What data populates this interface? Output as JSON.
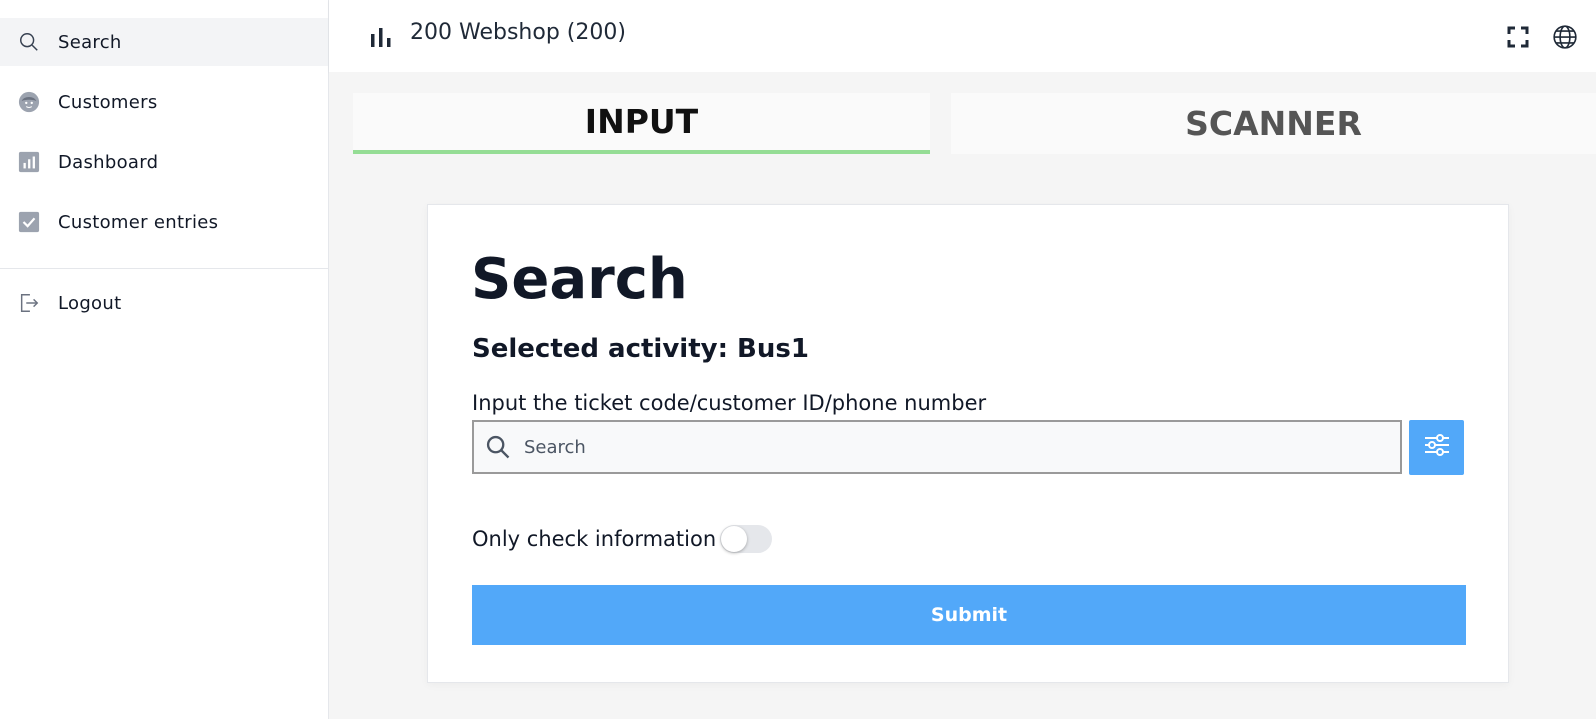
{
  "sidebar": {
    "items": [
      {
        "label": "Search",
        "icon": "search-icon",
        "active": true
      },
      {
        "label": "Customers",
        "icon": "face-icon",
        "active": false
      },
      {
        "label": "Dashboard",
        "icon": "chart-icon",
        "active": false
      },
      {
        "label": "Customer entries",
        "icon": "check-icon",
        "active": false
      }
    ],
    "logout_label": "Logout"
  },
  "header": {
    "title": "200 Webshop (200)"
  },
  "tabs": [
    {
      "label": "INPUT",
      "active": true
    },
    {
      "label": "SCANNER",
      "active": false
    }
  ],
  "form": {
    "title": "Search",
    "activity": "Selected activity: Bus1",
    "field_label": "Input the ticket code/customer ID/phone number",
    "search_placeholder": "Search",
    "search_value": "",
    "toggle_label": "Only check information",
    "toggle_on": false,
    "submit_label": "Submit"
  },
  "colors": {
    "accent": "#52a8f9",
    "active_tab_underline": "#95dd95",
    "icon_gray": "#9ca3af"
  }
}
